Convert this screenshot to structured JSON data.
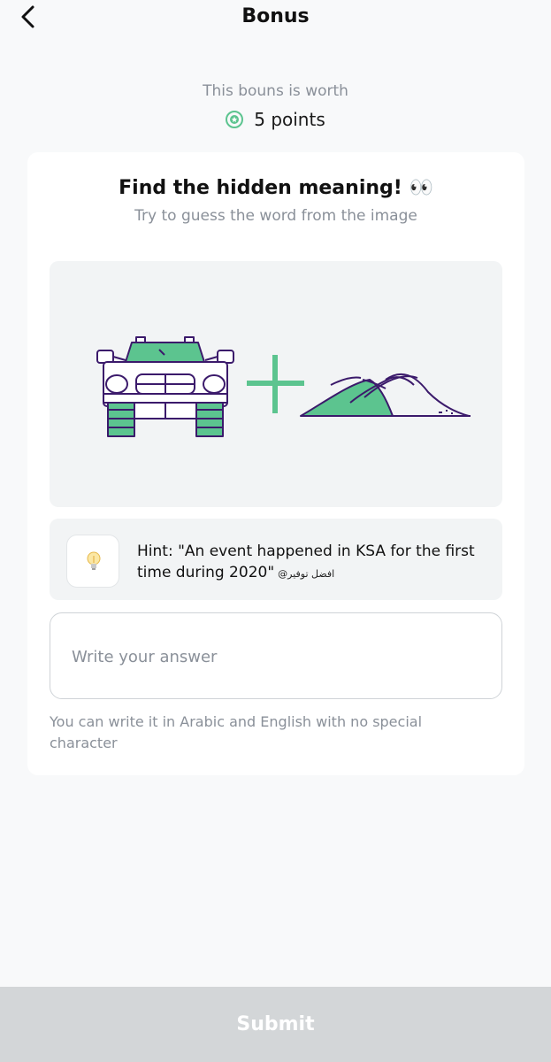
{
  "header": {
    "title": "Bonus",
    "back_icon": "chevron-left-icon"
  },
  "bonus": {
    "worth_label": "This bouns is worth",
    "points_text": "5 points",
    "points_icon": "points-badge-icon"
  },
  "puzzle": {
    "title": "Find the hidden meaning! 👀",
    "subtitle": "Try to guess the word from the image",
    "image_icons": [
      "car-icon",
      "plus-icon",
      "dunes-icon"
    ],
    "accent_color": "#5cc48f",
    "outline_color": "#3b1a6b"
  },
  "hint": {
    "icon": "lightbulb-icon",
    "text": "Hint:  \"An event happened in KSA for the first time during 2020\"",
    "watermark": "@افضل توفير"
  },
  "answer": {
    "placeholder": "Write your answer",
    "value": "",
    "helper": "You can write it in Arabic and English with no special character"
  },
  "submit": {
    "label": "Submit",
    "bar_color": "#d3d6d8"
  }
}
